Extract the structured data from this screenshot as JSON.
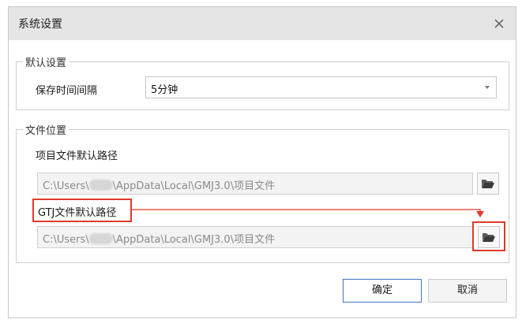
{
  "dialog": {
    "title": "系统设置",
    "close_icon": "close-icon"
  },
  "default_settings": {
    "legend": "默认设置",
    "save_interval_label": "保存时间间隔",
    "save_interval_value": "5分钟"
  },
  "file_location": {
    "legend": "文件位置",
    "project_path_label": "项目文件默认路径",
    "project_path_prefix": "C:\\Users\\",
    "project_path_suffix": "\\AppData\\Local\\GMJ3.0\\项目文件",
    "gtj_path_label": "GTJ文件默认路径",
    "gtj_path_prefix": "C:\\Users\\",
    "gtj_path_suffix": "\\AppData\\Local\\GMJ3.0\\项目文件",
    "browse_icon": "folder-open-icon"
  },
  "buttons": {
    "ok": "确定",
    "cancel": "取消"
  },
  "colors": {
    "highlight": "#e0392b",
    "primary_border": "#3f74c4",
    "titlebar": "#e5e5e5"
  }
}
